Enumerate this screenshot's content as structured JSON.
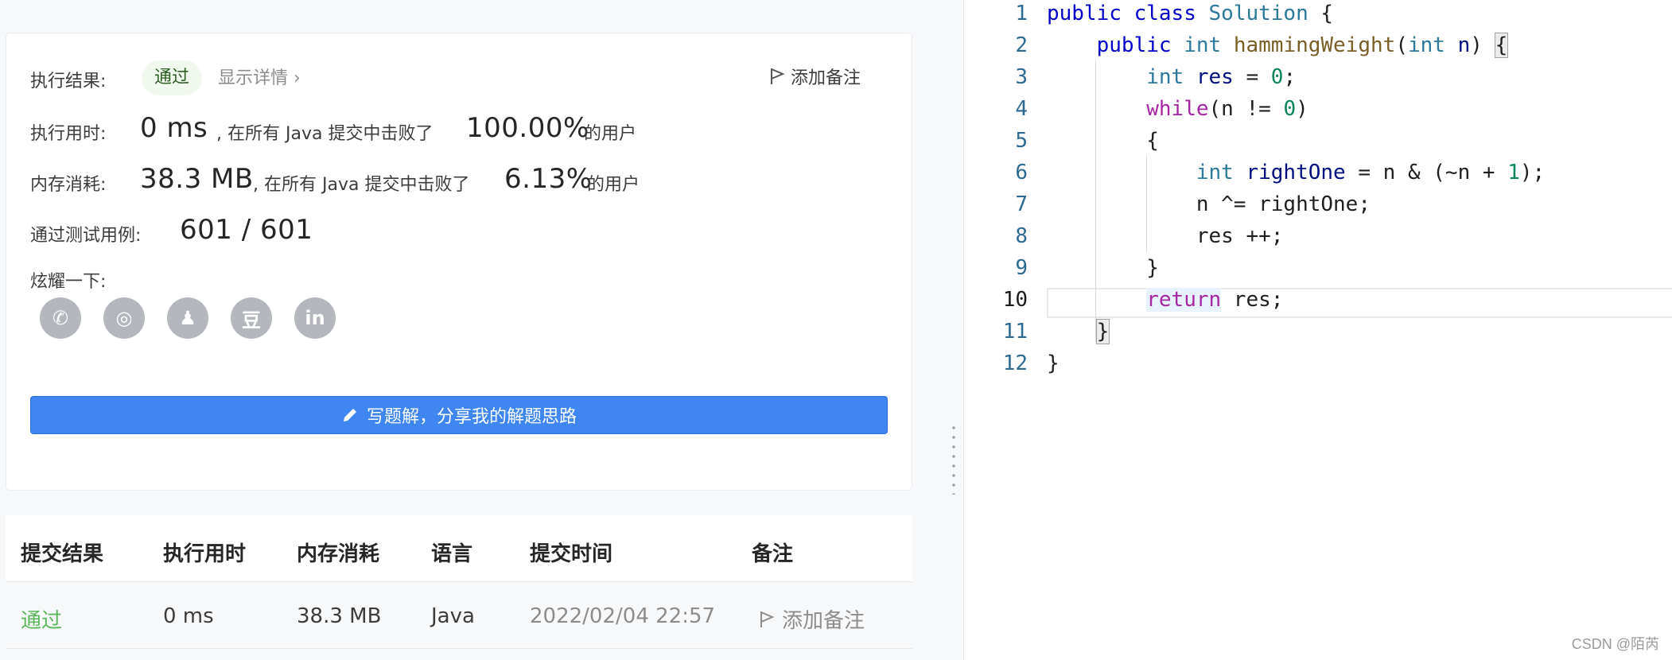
{
  "result": {
    "result_label": "执行结果:",
    "status": "通过",
    "details_link": "显示详情 ›",
    "add_note": "添加备注",
    "runtime_label": "执行用时:",
    "runtime_value": "0 ms",
    "runtime_mid": ", 在所有 Java 提交中击败了",
    "runtime_percent": "100.00%",
    "runtime_tail": "的用户",
    "memory_label": "内存消耗:",
    "memory_value": "38.3 MB",
    "memory_mid": ", 在所有 Java 提交中击败了",
    "memory_percent": "6.13%",
    "memory_tail": "的用户",
    "tests_label": "通过测试用例:",
    "tests_value": "601 / 601",
    "share_label": "炫耀一下:",
    "share_icons": [
      "wechat-icon",
      "weibo-icon",
      "qq-icon",
      "douban-icon",
      "linkedin-icon"
    ],
    "share_glyphs": [
      "✆",
      "◎",
      "♟",
      "豆",
      "in"
    ],
    "write_button": "写题解，分享我的解题思路"
  },
  "table": {
    "headers": [
      "提交结果",
      "执行用时",
      "内存消耗",
      "语言",
      "提交时间",
      "备注"
    ],
    "row": {
      "status": "通过",
      "runtime": "0 ms",
      "memory": "38.3 MB",
      "language": "Java",
      "time": "2022/02/04 22:57",
      "note": "添加备注"
    }
  },
  "editor": {
    "line_numbers": [
      "1",
      "2",
      "3",
      "4",
      "5",
      "6",
      "7",
      "8",
      "9",
      "10",
      "11",
      "12"
    ],
    "lines": [
      "public class Solution {",
      "    public int hammingWeight(int n) {",
      "        int res = 0;",
      "        while(n != 0)",
      "        {",
      "            int rightOne = n & (~n + 1);",
      "            n ^= rightOne;",
      "            res ++;",
      "        }",
      "        return res;",
      "    }",
      "}"
    ],
    "current_line": "10"
  },
  "watermark": "CSDN @陌芮",
  "colors": {
    "accent": "#3f86f0",
    "pass_green": "#5cb85c",
    "line_number": "#2d6a91"
  }
}
